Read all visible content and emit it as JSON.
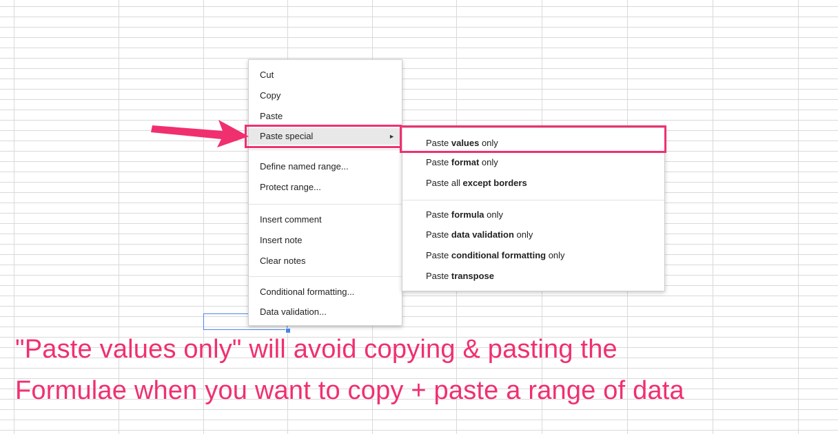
{
  "context_menu": {
    "items": [
      {
        "label": "Cut"
      },
      {
        "label": "Copy"
      },
      {
        "label": "Paste"
      },
      {
        "label": "Paste special"
      },
      {
        "label": "Define named range..."
      },
      {
        "label": "Protect range..."
      },
      {
        "label": "Insert comment"
      },
      {
        "label": "Insert note"
      },
      {
        "label": "Clear notes"
      },
      {
        "label": "Conditional formatting..."
      },
      {
        "label": "Data validation..."
      }
    ],
    "submenu_arrow": "►"
  },
  "paste_submenu": {
    "items": [
      {
        "prefix": "Paste ",
        "bold": "values",
        "suffix": " only"
      },
      {
        "prefix": "Paste ",
        "bold": "format",
        "suffix": " only"
      },
      {
        "prefix": "Paste all ",
        "bold": "except borders",
        "suffix": ""
      },
      {
        "prefix": "Paste ",
        "bold": "formula",
        "suffix": " only"
      },
      {
        "prefix": "Paste ",
        "bold": "data validation",
        "suffix": " only"
      },
      {
        "prefix": "Paste ",
        "bold": "conditional formatting",
        "suffix": " only"
      },
      {
        "prefix": "Paste ",
        "bold": "transpose",
        "suffix": ""
      }
    ]
  },
  "annotation": {
    "line1": "\"Paste values only\" will avoid copying & pasting the",
    "line2": "Formulae when you want to copy + paste a range of data",
    "color": "#f0306e"
  }
}
